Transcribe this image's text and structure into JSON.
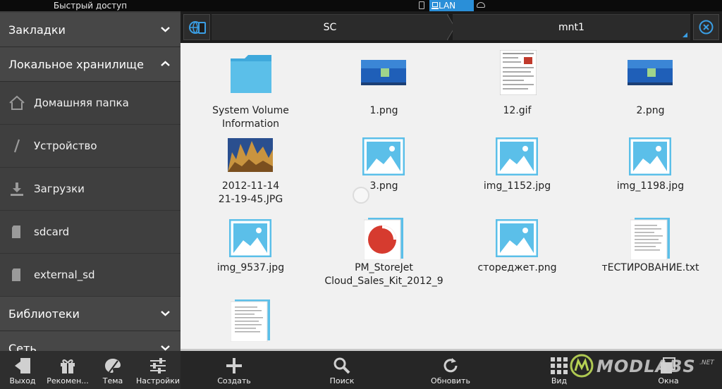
{
  "status_bar": {
    "title": "Быстрый доступ",
    "network_label": "LAN"
  },
  "sidebar": {
    "sections": [
      {
        "label": "Закладки",
        "expanded": false
      },
      {
        "label": "Локальное хранилище",
        "expanded": true
      },
      {
        "label": "Библиотеки",
        "expanded": false
      },
      {
        "label": "Сеть",
        "expanded": false
      }
    ],
    "items": [
      {
        "label": "Домашняя папка",
        "icon": "home-icon"
      },
      {
        "label": "Устройство",
        "icon": "slash-icon"
      },
      {
        "label": "Загрузки",
        "icon": "download-icon"
      },
      {
        "label": "sdcard",
        "icon": "sdcard-icon"
      },
      {
        "label": "external_sd",
        "icon": "sdcard-icon"
      }
    ]
  },
  "pathbar": {
    "crumbs": [
      "SC",
      "mnt1"
    ]
  },
  "files": [
    {
      "name": "System Volume\nInformation",
      "type": "folder"
    },
    {
      "name": "1.png",
      "type": "screenshot"
    },
    {
      "name": "12.gif",
      "type": "document-thumb"
    },
    {
      "name": "2.png",
      "type": "screenshot"
    },
    {
      "name": "2012-11-14\n21-19-45.JPG",
      "type": "photo"
    },
    {
      "name": "3.png",
      "type": "image-placeholder"
    },
    {
      "name": "img_1152.jpg",
      "type": "image-placeholder"
    },
    {
      "name": "img_1198.jpg",
      "type": "image-placeholder"
    },
    {
      "name": "img_9537.jpg",
      "type": "image-placeholder"
    },
    {
      "name": "PM_StoreJet\nCloud_Sales_Kit_2012_9",
      "type": "presentation"
    },
    {
      "name": "сторeджет.png",
      "type": "image-placeholder"
    },
    {
      "name": "тЕСТИРОВАНИЕ.txt",
      "type": "text"
    },
    {
      "name": "",
      "type": "text"
    }
  ],
  "toolbar_left": [
    {
      "label": "Выход",
      "icon": "exit-icon"
    },
    {
      "label": "Рекомен...",
      "icon": "gift-icon"
    },
    {
      "label": "Тема",
      "icon": "palette-icon"
    },
    {
      "label": "Настройки",
      "icon": "settings-icon"
    }
  ],
  "toolbar_right": [
    {
      "label": "Создать",
      "icon": "plus-icon"
    },
    {
      "label": "Поиск",
      "icon": "search-icon"
    },
    {
      "label": "Обновить",
      "icon": "refresh-icon"
    },
    {
      "label": "Вид",
      "icon": "grid-view-icon"
    },
    {
      "label": "Окна",
      "icon": "windows-icon"
    }
  ],
  "watermark": {
    "text": "MODLABS",
    "suffix": ".NET"
  },
  "colors": {
    "accent": "#2a8fd8",
    "sidebar_bg": "#3f3f3f",
    "content_bg": "#f1f1f1",
    "folder": "#5bbfe9"
  }
}
